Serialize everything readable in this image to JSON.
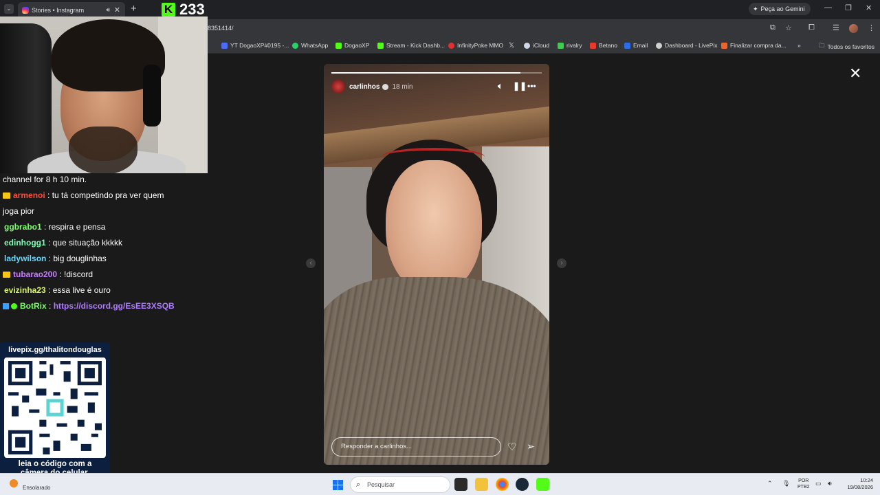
{
  "browser": {
    "tab_title": "Stories • Instagram",
    "new_tab": "+",
    "gemini_label": "Peça ao Gemini",
    "url": "8351414/",
    "bookmarks": [
      {
        "label": "YT DogaoXP#0195 -...",
        "color": "#4a6cf7"
      },
      {
        "label": "WhatsApp",
        "color": "#25d366"
      },
      {
        "label": "DogaoXP",
        "color": "#53fc18"
      },
      {
        "label": "Stream - Kick Dashb...",
        "color": "#53fc18"
      },
      {
        "label": "InfinityPoke MMO",
        "color": "#e03030"
      },
      {
        "label": "iCloud",
        "color": "#ffffff"
      },
      {
        "label": "rivalry",
        "color": "#3ccf4e"
      },
      {
        "label": "Betano",
        "color": "#e8392b"
      },
      {
        "label": "Email",
        "color": "#2b6de8"
      },
      {
        "label": "Dashboard - LivePix",
        "color": "#cfcfcf"
      },
      {
        "label": "Finalizar compra da...",
        "color": "#f0642a"
      }
    ],
    "all_favorites": "Todos os favoritos"
  },
  "kick": {
    "logo": "K",
    "viewer_count": "233"
  },
  "chat": {
    "partial_top": "channel for 8 h 10 min.",
    "messages": [
      {
        "user": "armenoi",
        "text": " : tu tá competindo pra ver quem",
        "cont": "joga pior",
        "color": "#ff4d3d",
        "badge": "crown"
      },
      {
        "user": "ggbrabo1",
        "text": " : respira e pensa",
        "color": "#7dff6a",
        "badge": ""
      },
      {
        "user": "edinhogg1",
        "text": " : que situação kkkkk",
        "color": "#7dffb5",
        "badge": ""
      },
      {
        "user": "ladywilson",
        "text": " : big douglinhas",
        "color": "#64d8ff",
        "badge": ""
      },
      {
        "user": "tubarao200",
        "text": " : !discord",
        "color": "#c77dff",
        "badge": "crown"
      },
      {
        "user": "evizinha23",
        "text": " : essa live é ouro",
        "color": "#d9f56a",
        "badge": ""
      },
      {
        "user": "BotRix",
        "text": " : ",
        "link": "https://discord.gg/EsEE3XSQB",
        "color": "#7dff6a",
        "badge": "bot"
      }
    ]
  },
  "qr": {
    "title": "livepix.gg/thalitondouglas",
    "caption_line1": "leia o código com a",
    "caption_line2": "câmera do celular."
  },
  "story": {
    "username": "carlinhos",
    "time": "18 min",
    "reply_placeholder": "Responder a carlinhos...",
    "progress": 0.9
  },
  "taskbar": {
    "weather": "Ensolarado",
    "search_placeholder": "Pesquisar",
    "lang_line1": "POR",
    "lang_line2": "PTB2",
    "time": "10:24",
    "date": "19/08/2026"
  }
}
